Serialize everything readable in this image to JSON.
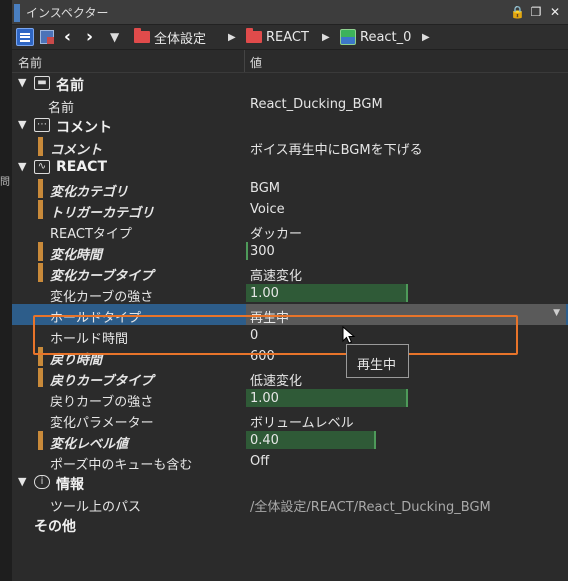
{
  "window": {
    "title": "インスペクター"
  },
  "toolbar": {
    "breadcrumbs": [
      "全体設定",
      "REACT",
      "React_0"
    ]
  },
  "columns": {
    "name": "名前",
    "value": "値"
  },
  "sections": {
    "name": {
      "label": "名前",
      "row_label": "名前",
      "row_value": "React_Ducking_BGM"
    },
    "comment": {
      "label": "コメント",
      "row_label": "コメント",
      "row_value": "ボイス再生中にBGMを下げる"
    },
    "react": {
      "label": "REACT"
    },
    "info": {
      "label": "情報",
      "row_label": "ツール上のパス",
      "row_value": "/全体設定/REACT/React_Ducking_BGM"
    },
    "other": {
      "label": "その他"
    }
  },
  "react_rows": [
    {
      "label": "変化カテゴリ",
      "value": "BGM"
    },
    {
      "label": "トリガーカテゴリ",
      "value": "Voice"
    },
    {
      "label": "REACTタイプ",
      "value": "ダッカー"
    },
    {
      "label": "変化時間",
      "value": "300"
    },
    {
      "label": "変化カーブタイプ",
      "value": "高速変化"
    },
    {
      "label": "変化カーブの強さ",
      "value": "1.00",
      "fill": 0.5
    },
    {
      "label": "ホールドタイプ",
      "value": "再生中"
    },
    {
      "label": "ホールド時間",
      "value": "0"
    },
    {
      "label": "戻り時間",
      "value": "600"
    },
    {
      "label": "戻りカーブタイプ",
      "value": "低速変化"
    },
    {
      "label": "戻りカーブの強さ",
      "value": "1.00",
      "fill": 0.5
    },
    {
      "label": "変化パラメーター",
      "value": "ボリュームレベル"
    },
    {
      "label": "変化レベル値",
      "value": "0.40",
      "fill": 0.4
    },
    {
      "label": "ポーズ中のキューも含む",
      "value": "Off"
    }
  ],
  "tooltip": {
    "text": "再生中"
  },
  "colors": {
    "accent": "#2d5d8a",
    "highlight_box": "#e8742a",
    "bar": "#c98a3a",
    "fill": "#2f5a37"
  }
}
